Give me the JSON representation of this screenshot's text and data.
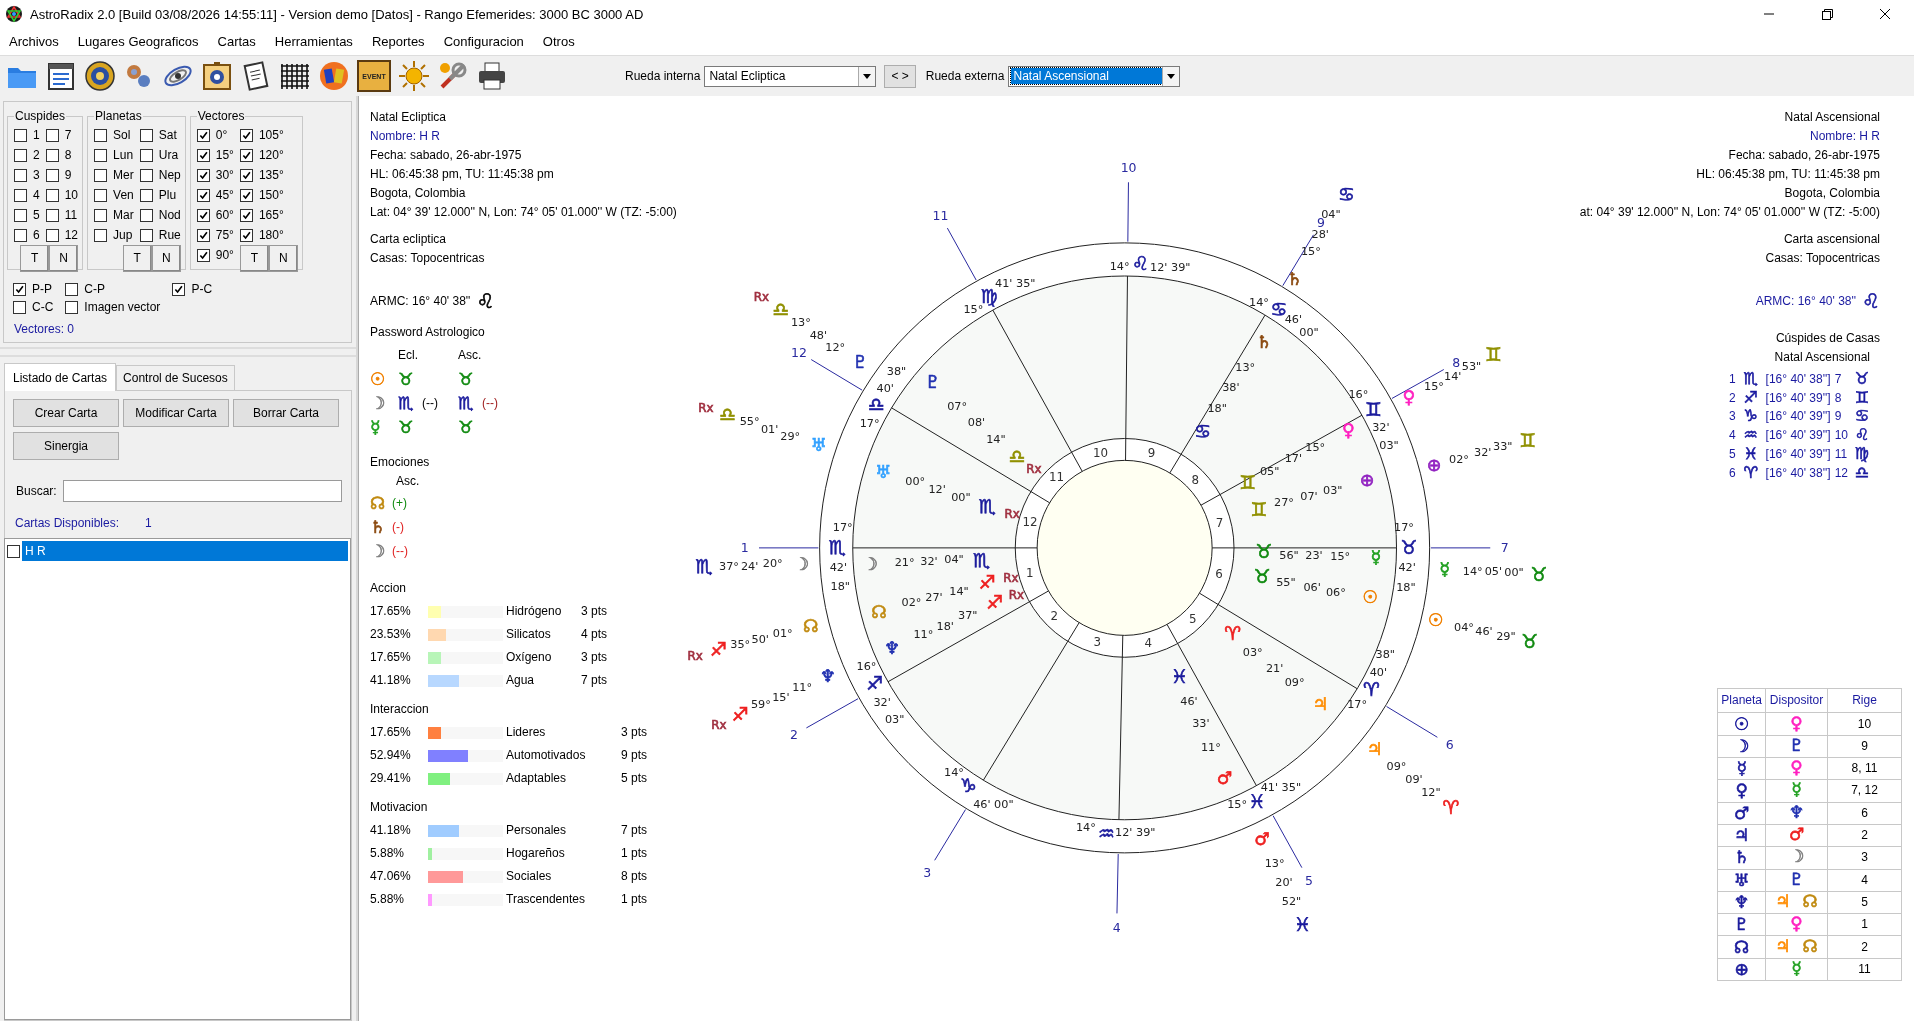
{
  "window": {
    "title": "AstroRadix 2.0 [Build 03/08/2026 14:55:11] - Version demo [Datos] - Rango Efemerides: 3000 BC  3000 AD"
  },
  "menu": [
    "Archivos",
    "Lugares Geograficos",
    "Cartas",
    "Herramientas",
    "Reportes",
    "Configuracion",
    "Otros"
  ],
  "toolbar": {
    "event_sign": "EVENT",
    "inner_wheel": {
      "label": "Rueda interna",
      "value": "Natal Ecliptica",
      "focused": false
    },
    "swap_button": "< >",
    "outer_wheel": {
      "label": "Rueda externa",
      "value": "Natal Ascensional",
      "focused": true
    }
  },
  "filters": {
    "groups": [
      {
        "title": "Cuspides",
        "items": [
          {
            "label": "1",
            "checked": false
          },
          {
            "label": "2",
            "checked": false
          },
          {
            "label": "3",
            "checked": false
          },
          {
            "label": "4",
            "checked": false
          },
          {
            "label": "5",
            "checked": false
          },
          {
            "label": "6",
            "checked": false
          },
          {
            "label": "7",
            "checked": false
          },
          {
            "label": "8",
            "checked": false
          },
          {
            "label": "9",
            "checked": false
          },
          {
            "label": "10",
            "checked": false
          },
          {
            "label": "11",
            "checked": false
          },
          {
            "label": "12",
            "checked": false
          }
        ],
        "buttons": [
          "T",
          "N"
        ]
      },
      {
        "title": "Planetas",
        "items": [
          {
            "label": "Sol",
            "checked": false
          },
          {
            "label": "Lun",
            "checked": false
          },
          {
            "label": "Mer",
            "checked": false
          },
          {
            "label": "Ven",
            "checked": false
          },
          {
            "label": "Mar",
            "checked": false
          },
          {
            "label": "Jup",
            "checked": false
          },
          {
            "label": "Sat",
            "checked": false
          },
          {
            "label": "Ura",
            "checked": false
          },
          {
            "label": "Nep",
            "checked": false
          },
          {
            "label": "Plu",
            "checked": false
          },
          {
            "label": "Nod",
            "checked": false
          },
          {
            "label": "Rue",
            "checked": false
          }
        ],
        "buttons": [
          "T",
          "N"
        ]
      },
      {
        "title": "Vectores",
        "items": [
          {
            "label": "0°",
            "checked": true
          },
          {
            "label": "15°",
            "checked": true
          },
          {
            "label": "30°",
            "checked": true
          },
          {
            "label": "45°",
            "checked": true
          },
          {
            "label": "60°",
            "checked": true
          },
          {
            "label": "75°",
            "checked": true
          },
          {
            "label": "90°",
            "checked": true
          },
          {
            "label": "105°",
            "checked": true
          },
          {
            "label": "120°",
            "checked": true
          },
          {
            "label": "135°",
            "checked": true
          },
          {
            "label": "150°",
            "checked": true
          },
          {
            "label": "165°",
            "checked": true
          },
          {
            "label": "180°",
            "checked": true
          }
        ],
        "buttons": [
          "T",
          "N"
        ]
      }
    ],
    "options": [
      {
        "label": "P-P",
        "checked": true
      },
      {
        "label": "C-P",
        "checked": false
      },
      {
        "label": "P-C",
        "checked": true
      },
      {
        "label": "C-C",
        "checked": false
      },
      {
        "label": "Imagen vector",
        "checked": false
      }
    ],
    "vectors_count": "Vectores: 0"
  },
  "charts_panel": {
    "tabs": [
      {
        "label": "Listado de Cartas",
        "selected": true
      },
      {
        "label": "Control de Sucesos",
        "selected": false
      }
    ],
    "buttons": [
      "Crear Carta",
      "Modificar Carta",
      "Borrar Carta",
      "Sinergia"
    ],
    "search": {
      "label": "Buscar:"
    },
    "available": {
      "label": "Cartas Disponibles:",
      "count": "1"
    },
    "list": [
      {
        "label": "H R",
        "checked": false,
        "selected": true
      }
    ]
  },
  "inner_info": {
    "title": "Natal Ecliptica",
    "name": "Nombre: H R",
    "date": "Fecha: sabado, 26-abr-1975",
    "time": "HL: 06:45:38 pm, TU: 11:45:38 pm",
    "place": "Bogota, Colombia",
    "coords": "Lat: 04° 39' 12.000'' N, Lon: 74° 05' 01.000'' W (TZ: -5:00)",
    "chart_type": "Carta ecliptica",
    "houses": "Casas: Topocentricas",
    "armc": {
      "text": "ARMC: 16° 40' 38''",
      "sign": "♌"
    }
  },
  "password": {
    "title": "Password Astrologico",
    "columns": [
      "Ecl.",
      "Asc."
    ],
    "rows": [
      {
        "planet": {
          "glyph": "☉",
          "color": "#f08000"
        },
        "ecl": {
          "glyph": "♉",
          "color": "#108a10"
        },
        "asc": {
          "glyph": "♉",
          "color": "#108a10"
        }
      },
      {
        "planet": {
          "glyph": "☽",
          "color": "#808080"
        },
        "ecl": {
          "glyph": "♏",
          "color": "#1a1a9c",
          "note": "(--)"
        },
        "asc": {
          "glyph": "♏",
          "color": "#1a1a9c",
          "note": "(--)"
        }
      },
      {
        "planet": {
          "glyph": "☿",
          "color": "#20a020"
        },
        "ecl": {
          "glyph": "♉",
          "color": "#108a10"
        },
        "asc": {
          "glyph": "♉",
          "color": "#108a10"
        }
      }
    ]
  },
  "emotions": {
    "title": "Emociones",
    "column": "Asc.",
    "rows": [
      {
        "planet": {
          "glyph": "☊",
          "color": "#c08a10"
        },
        "note": {
          "text": "(+)",
          "color": "#108a10"
        }
      },
      {
        "planet": {
          "glyph": "♄",
          "color": "#8b4a10"
        },
        "note": {
          "text": "(-)",
          "color": "#e02020"
        }
      },
      {
        "planet": {
          "glyph": "☽",
          "color": "#808080"
        },
        "note": {
          "text": "(--)",
          "color": "#e02020"
        }
      }
    ]
  },
  "stats": [
    {
      "title": "Accion",
      "rows": [
        {
          "percent": "17.65%",
          "level": 0.1765,
          "color": "#ffffb0",
          "label": "Hidrógeno",
          "points": "3 pts"
        },
        {
          "percent": "23.53%",
          "level": 0.2353,
          "color": "#ffd8b0",
          "label": "Silicatos",
          "points": "4 pts"
        },
        {
          "percent": "17.65%",
          "level": 0.1765,
          "color": "#b8f5b8",
          "label": "Oxígeno",
          "points": "3 pts"
        },
        {
          "percent": "41.18%",
          "level": 0.4118,
          "color": "#b8d8ff",
          "label": "Agua",
          "points": "7 pts"
        }
      ]
    },
    {
      "title": "Interaccion",
      "rows": [
        {
          "percent": "17.65%",
          "level": 0.1765,
          "color": "#ff8040",
          "label": "Lideres",
          "points": "3 pts"
        },
        {
          "percent": "52.94%",
          "level": 0.5294,
          "color": "#8080ff",
          "label": "Automotivados",
          "points": "9 pts"
        },
        {
          "percent": "29.41%",
          "level": 0.2941,
          "color": "#80f080",
          "label": "Adaptables",
          "points": "5 pts"
        }
      ]
    },
    {
      "title": "Motivacion",
      "rows": [
        {
          "percent": "41.18%",
          "level": 0.4118,
          "color": "#a0ccff",
          "label": "Personales",
          "points": "7 pts"
        },
        {
          "percent": "5.88%",
          "level": 0.0588,
          "color": "#a0f0a0",
          "label": "Hogareños",
          "points": "1 pts"
        },
        {
          "percent": "47.06%",
          "level": 0.4706,
          "color": "#ff9999",
          "label": "Sociales",
          "points": "8 pts"
        },
        {
          "percent": "5.88%",
          "level": 0.0588,
          "color": "#ff99ff",
          "label": "Trascendentes",
          "points": "1 pts"
        }
      ]
    }
  ],
  "wheel": {
    "house_numbers_outer": [
      "1",
      "2",
      "3",
      "4",
      "5",
      "6",
      "7",
      "8",
      "9",
      "10",
      "11",
      "12"
    ],
    "house_numbers_inner": [
      "1",
      "2",
      "3",
      "4",
      "5",
      "6",
      "7",
      "8",
      "9",
      "10",
      "11",
      "12"
    ],
    "labels": [
      {
        "kind": "deg",
        "text": "14°"
      },
      {
        "kind": "sign",
        "text": "♌",
        "color": "#1a1a9c"
      },
      {
        "kind": "deg",
        "text": "12' 39\""
      },
      {
        "kind": "deg",
        "text": "15°"
      },
      {
        "kind": "sign",
        "text": "♍",
        "color": "#1a1a9c"
      },
      {
        "kind": "deg",
        "text": "41' 35\""
      },
      {
        "kind": "deg",
        "text": "38\""
      },
      {
        "kind": "deg",
        "text": "40'"
      },
      {
        "kind": "sign",
        "text": "♎",
        "color": "#1a1a9c"
      },
      {
        "kind": "deg",
        "text": "17°"
      },
      {
        "kind": "deg",
        "text": "17°"
      },
      {
        "kind": "sign",
        "text": "♏",
        "color": "#1a1a9c"
      },
      {
        "kind": "deg",
        "text": "42'"
      },
      {
        "kind": "deg",
        "text": "18\""
      },
      {
        "kind": "deg",
        "text": "16°"
      },
      {
        "kind": "sign",
        "text": "♐",
        "color": "#1a1a9c"
      },
      {
        "kind": "deg",
        "text": "32'"
      },
      {
        "kind": "deg",
        "text": "03\""
      },
      {
        "kind": "deg",
        "text": "14°"
      },
      {
        "kind": "sign",
        "text": "♑",
        "color": "#1a1a9c"
      },
      {
        "kind": "deg",
        "text": "46' 00\""
      },
      {
        "kind": "deg",
        "text": "14°"
      },
      {
        "kind": "sign",
        "text": "♒",
        "color": "#1a1a9c"
      },
      {
        "kind": "deg",
        "text": "12' 39\""
      },
      {
        "kind": "deg",
        "text": "15°"
      },
      {
        "kind": "sign",
        "text": "♓",
        "color": "#1a1a9c"
      },
      {
        "kind": "deg",
        "text": "41' 35\""
      },
      {
        "kind": "deg",
        "text": "38\""
      },
      {
        "kind": "deg",
        "text": "40'"
      },
      {
        "kind": "sign",
        "text": "♈",
        "color": "#1a1a9c"
      },
      {
        "kind": "deg",
        "text": "17°"
      },
      {
        "kind": "deg",
        "text": "17°"
      },
      {
        "kind": "sign",
        "text": "♉",
        "color": "#1a1a9c"
      },
      {
        "kind": "deg",
        "text": "42'"
      },
      {
        "kind": "deg",
        "text": "18\""
      },
      {
        "kind": "deg",
        "text": "16°"
      },
      {
        "kind": "sign",
        "text": "♊",
        "color": "#1a1a9c"
      },
      {
        "kind": "deg",
        "text": "32'"
      },
      {
        "kind": "deg",
        "text": "03\""
      },
      {
        "kind": "deg",
        "text": "14°"
      },
      {
        "kind": "sign",
        "text": "♋",
        "color": "#1a1a9c"
      },
      {
        "kind": "deg",
        "text": "46'"
      },
      {
        "kind": "deg",
        "text": "00\""
      },
      {
        "kind": "rx",
        "text": "Rx",
        "color": "#a03040"
      },
      {
        "kind": "sign",
        "text": "♎",
        "color": "#909000"
      },
      {
        "kind": "deg",
        "text": "13°"
      },
      {
        "kind": "deg",
        "text": "48'"
      },
      {
        "kind": "deg",
        "text": "12°"
      },
      {
        "kind": "planet",
        "text": "♇",
        "color": "#2030b0"
      },
      {
        "kind": "rx",
        "text": "Rx",
        "color": "#a03040"
      },
      {
        "kind": "sign",
        "text": "♎",
        "color": "#909000"
      },
      {
        "kind": "deg",
        "text": "55°"
      },
      {
        "kind": "deg",
        "text": "01'"
      },
      {
        "kind": "deg",
        "text": "29°"
      },
      {
        "kind": "planet",
        "text": "♅",
        "color": "#30a0ff"
      },
      {
        "kind": "sign",
        "text": "♏",
        "color": "#1a1a9c"
      },
      {
        "kind": "deg",
        "text": "37°"
      },
      {
        "kind": "deg",
        "text": "24'"
      },
      {
        "kind": "deg",
        "text": "20°"
      },
      {
        "kind": "planet",
        "text": "☽",
        "color": "#808080"
      },
      {
        "kind": "rx",
        "text": "Rx",
        "color": "#a03040"
      },
      {
        "kind": "sign",
        "text": "♐",
        "color": "#ee2020"
      },
      {
        "kind": "deg",
        "text": "35°"
      },
      {
        "kind": "deg",
        "text": "50'"
      },
      {
        "kind": "deg",
        "text": "01°"
      },
      {
        "kind": "planet",
        "text": "☊",
        "color": "#c08a10"
      },
      {
        "kind": "rx",
        "text": "Rx",
        "color": "#a03040"
      },
      {
        "kind": "sign",
        "text": "♐",
        "color": "#ee2020"
      },
      {
        "kind": "deg",
        "text": "59°"
      },
      {
        "kind": "deg",
        "text": "15'"
      },
      {
        "kind": "deg",
        "text": "11°"
      },
      {
        "kind": "planet",
        "text": "♆",
        "color": "#2030b0"
      },
      {
        "kind": "planet",
        "text": "♄",
        "color": "#8b4a10"
      },
      {
        "kind": "deg",
        "text": "15°"
      },
      {
        "kind": "deg",
        "text": "28'"
      },
      {
        "kind": "deg",
        "text": "04\""
      },
      {
        "kind": "sign",
        "text": "♋",
        "color": "#1a1a9c"
      },
      {
        "kind": "planet",
        "text": "♀",
        "color": "#ff20c0"
      },
      {
        "kind": "deg",
        "text": "15°"
      },
      {
        "kind": "deg",
        "text": "14'"
      },
      {
        "kind": "deg",
        "text": "53\""
      },
      {
        "kind": "sign",
        "text": "♊",
        "color": "#909000"
      },
      {
        "kind": "planet",
        "text": "⊕",
        "color": "#9020c0"
      },
      {
        "kind": "deg",
        "text": "02°"
      },
      {
        "kind": "deg",
        "text": "32'"
      },
      {
        "kind": "deg",
        "text": "33\""
      },
      {
        "kind": "sign",
        "text": "♊",
        "color": "#909000"
      },
      {
        "kind": "planet",
        "text": "☿",
        "color": "#20a020"
      },
      {
        "kind": "deg",
        "text": "14°"
      },
      {
        "kind": "deg",
        "text": "05'"
      },
      {
        "kind": "deg",
        "text": "00\""
      },
      {
        "kind": "sign",
        "text": "♉",
        "color": "#108a10"
      },
      {
        "kind": "planet",
        "text": "☉",
        "color": "#f08000"
      },
      {
        "kind": "deg",
        "text": "04°"
      },
      {
        "kind": "deg",
        "text": "46'"
      },
      {
        "kind": "deg",
        "text": "29\""
      },
      {
        "kind": "sign",
        "text": "♉",
        "color": "#108a10"
      },
      {
        "kind": "planet",
        "text": "♃",
        "color": "#ff8c00"
      },
      {
        "kind": "deg",
        "text": "09°"
      },
      {
        "kind": "deg",
        "text": "09'"
      },
      {
        "kind": "deg",
        "text": "12\""
      },
      {
        "kind": "sign",
        "text": "♈",
        "color": "#ee2020"
      },
      {
        "kind": "planet",
        "text": "♂",
        "color": "#ee2020"
      },
      {
        "kind": "deg",
        "text": "13°"
      },
      {
        "kind": "deg",
        "text": "20'"
      },
      {
        "kind": "deg",
        "text": "52\""
      },
      {
        "kind": "sign",
        "text": "♓",
        "color": "#1a1a9c"
      },
      {
        "kind": "planet",
        "text": "♄",
        "color": "#8b4a10"
      },
      {
        "kind": "deg",
        "text": "13°"
      },
      {
        "kind": "deg",
        "text": "38'"
      },
      {
        "kind": "deg",
        "text": "18\""
      },
      {
        "kind": "sign",
        "text": "♋",
        "color": "#1a1a9c"
      },
      {
        "kind": "planet",
        "text": "♇",
        "color": "#2030b0"
      },
      {
        "kind": "deg",
        "text": "07°"
      },
      {
        "kind": "deg",
        "text": "08'"
      },
      {
        "kind": "deg",
        "text": "14\""
      },
      {
        "kind": "sign",
        "text": "♎",
        "color": "#909000"
      },
      {
        "kind": "planet",
        "text": "♅",
        "color": "#30a0ff"
      },
      {
        "kind": "rx",
        "text": "Rx",
        "color": "#a03040"
      },
      {
        "kind": "deg",
        "text": "00°"
      },
      {
        "kind": "deg",
        "text": "12'"
      },
      {
        "kind": "deg",
        "text": "00\""
      },
      {
        "kind": "sign",
        "text": "♏",
        "color": "#1a1a9c"
      },
      {
        "kind": "rx",
        "text": "Rx",
        "color": "#a03040"
      },
      {
        "kind": "planet",
        "text": "☽",
        "color": "#808080"
      },
      {
        "kind": "deg",
        "text": "21°"
      },
      {
        "kind": "deg",
        "text": "32'"
      },
      {
        "kind": "deg",
        "text": "04\""
      },
      {
        "kind": "sign",
        "text": "♏",
        "color": "#1a1a9c"
      },
      {
        "kind": "planet",
        "text": "☊",
        "color": "#c08a10"
      },
      {
        "kind": "deg",
        "text": "02°"
      },
      {
        "kind": "deg",
        "text": "27'"
      },
      {
        "kind": "deg",
        "text": "14\""
      },
      {
        "kind": "sign",
        "text": "♐",
        "color": "#ee2020"
      },
      {
        "kind": "rx",
        "text": "Rx",
        "color": "#a03040"
      },
      {
        "kind": "planet",
        "text": "♆",
        "color": "#2030b0"
      },
      {
        "kind": "deg",
        "text": "11°"
      },
      {
        "kind": "deg",
        "text": "18'"
      },
      {
        "kind": "deg",
        "text": "37\""
      },
      {
        "kind": "sign",
        "text": "♐",
        "color": "#ee2020"
      },
      {
        "kind": "rx",
        "text": "Rx",
        "color": "#a03040"
      },
      {
        "kind": "planet",
        "text": "♀",
        "color": "#ff20c0"
      },
      {
        "kind": "deg",
        "text": "15°"
      },
      {
        "kind": "deg",
        "text": "17'"
      },
      {
        "kind": "deg",
        "text": "05\""
      },
      {
        "kind": "sign",
        "text": "♊",
        "color": "#909000"
      },
      {
        "kind": "planet",
        "text": "⊕",
        "color": "#9020c0"
      },
      {
        "kind": "deg",
        "text": "03\""
      },
      {
        "kind": "deg",
        "text": "07'"
      },
      {
        "kind": "deg",
        "text": "27°"
      },
      {
        "kind": "sign",
        "text": "♊",
        "color": "#909000"
      },
      {
        "kind": "sign",
        "text": "♉",
        "color": "#108a10"
      },
      {
        "kind": "deg",
        "text": "56\""
      },
      {
        "kind": "deg",
        "text": "23'"
      },
      {
        "kind": "deg",
        "text": "15°"
      },
      {
        "kind": "planet",
        "text": "☿",
        "color": "#20a020"
      },
      {
        "kind": "sign",
        "text": "♉",
        "color": "#108a10"
      },
      {
        "kind": "deg",
        "text": "55\""
      },
      {
        "kind": "deg",
        "text": "06'"
      },
      {
        "kind": "deg",
        "text": "06°"
      },
      {
        "kind": "planet",
        "text": "☉",
        "color": "#f08000"
      },
      {
        "kind": "sign",
        "text": "♈",
        "color": "#ee2020"
      },
      {
        "kind": "deg",
        "text": "03°"
      },
      {
        "kind": "deg",
        "text": "21'"
      },
      {
        "kind": "deg",
        "text": "09°"
      },
      {
        "kind": "planet",
        "text": "♃",
        "color": "#ff8c00"
      },
      {
        "kind": "sign",
        "text": "♓",
        "color": "#1a1a9c"
      },
      {
        "kind": "deg",
        "text": "46'"
      },
      {
        "kind": "deg",
        "text": "33'"
      },
      {
        "kind": "deg",
        "text": "11°"
      },
      {
        "kind": "planet",
        "text": "♂",
        "color": "#ee2020"
      }
    ]
  },
  "outer_info": {
    "title": "Natal Ascensional",
    "name": "Nombre: H R",
    "date": "Fecha: sabado, 26-abr-1975",
    "time": "HL: 06:45:38 pm, TU: 11:45:38 pm",
    "place": "Bogota, Colombia",
    "coords": "at: 04° 39' 12.000'' N, Lon: 74° 05' 01.000'' W (TZ: -5:00)",
    "chart_type": "Carta ascensional",
    "houses": "Casas: Topocentricas",
    "armc": {
      "text": "ARMC: 16° 40' 38''",
      "sign": "♌"
    },
    "cusps_title": "Cúspides de Casas",
    "cusps_subtitle": "Natal Ascensional",
    "cusps": [
      {
        "house": "1",
        "sign": "♏",
        "position": "[16° 40' 38'']",
        "opposite_house": "7",
        "opposite_sign": "♉"
      },
      {
        "house": "2",
        "sign": "♐",
        "position": "[16° 40' 39'']",
        "opposite_house": "8",
        "opposite_sign": "♊"
      },
      {
        "house": "3",
        "sign": "♑",
        "position": "[16° 40' 39'']",
        "opposite_house": "9",
        "opposite_sign": "♋"
      },
      {
        "house": "4",
        "sign": "♒",
        "position": "[16° 40' 39'']",
        "opposite_house": "10",
        "opposite_sign": "♌"
      },
      {
        "house": "5",
        "sign": "♓",
        "position": "[16° 40' 39'']",
        "opposite_house": "11",
        "opposite_sign": "♍"
      },
      {
        "house": "6",
        "sign": "♈",
        "position": "[16° 40' 38'']",
        "opposite_house": "12",
        "opposite_sign": "♎"
      }
    ]
  },
  "dispositors": {
    "columns": [
      "Planeta",
      "Dispositor",
      "Rige"
    ],
    "rows": [
      {
        "planet": "☉",
        "dispositors": [
          {
            "glyph": "♀",
            "color": "#ff20c0"
          }
        ],
        "rules": "10"
      },
      {
        "planet": "☽",
        "dispositors": [
          {
            "glyph": "♇",
            "color": "#2030b0"
          }
        ],
        "rules": "9"
      },
      {
        "planet": "☿",
        "dispositors": [
          {
            "glyph": "♀",
            "color": "#ff20c0"
          }
        ],
        "rules": "8, 11"
      },
      {
        "planet": "♀",
        "dispositors": [
          {
            "glyph": "☿",
            "color": "#20a020"
          }
        ],
        "rules": "7, 12"
      },
      {
        "planet": "♂",
        "dispositors": [
          {
            "glyph": "♆",
            "color": "#2030b0"
          }
        ],
        "rules": "6"
      },
      {
        "planet": "♃",
        "dispositors": [
          {
            "glyph": "♂",
            "color": "#ee2020"
          }
        ],
        "rules": "2"
      },
      {
        "planet": "♄",
        "dispositors": [
          {
            "glyph": "☽",
            "color": "#808080"
          }
        ],
        "rules": "3"
      },
      {
        "planet": "♅",
        "dispositors": [
          {
            "glyph": "♇",
            "color": "#2030b0"
          }
        ],
        "rules": "4"
      },
      {
        "planet": "♆",
        "dispositors": [
          {
            "glyph": "♃",
            "color": "#ff8c00"
          },
          {
            "glyph": "☊",
            "color": "#c08a10"
          }
        ],
        "rules": "5"
      },
      {
        "planet": "♇",
        "dispositors": [
          {
            "glyph": "♀",
            "color": "#ff20c0"
          }
        ],
        "rules": "1"
      },
      {
        "planet": "☊",
        "dispositors": [
          {
            "glyph": "♃",
            "color": "#ff8c00"
          },
          {
            "glyph": "☊",
            "color": "#c08a10"
          }
        ],
        "rules": "2"
      },
      {
        "planet": "⊕",
        "dispositors": [
          {
            "glyph": "☿",
            "color": "#20a020"
          }
        ],
        "rules": "11"
      }
    ]
  }
}
